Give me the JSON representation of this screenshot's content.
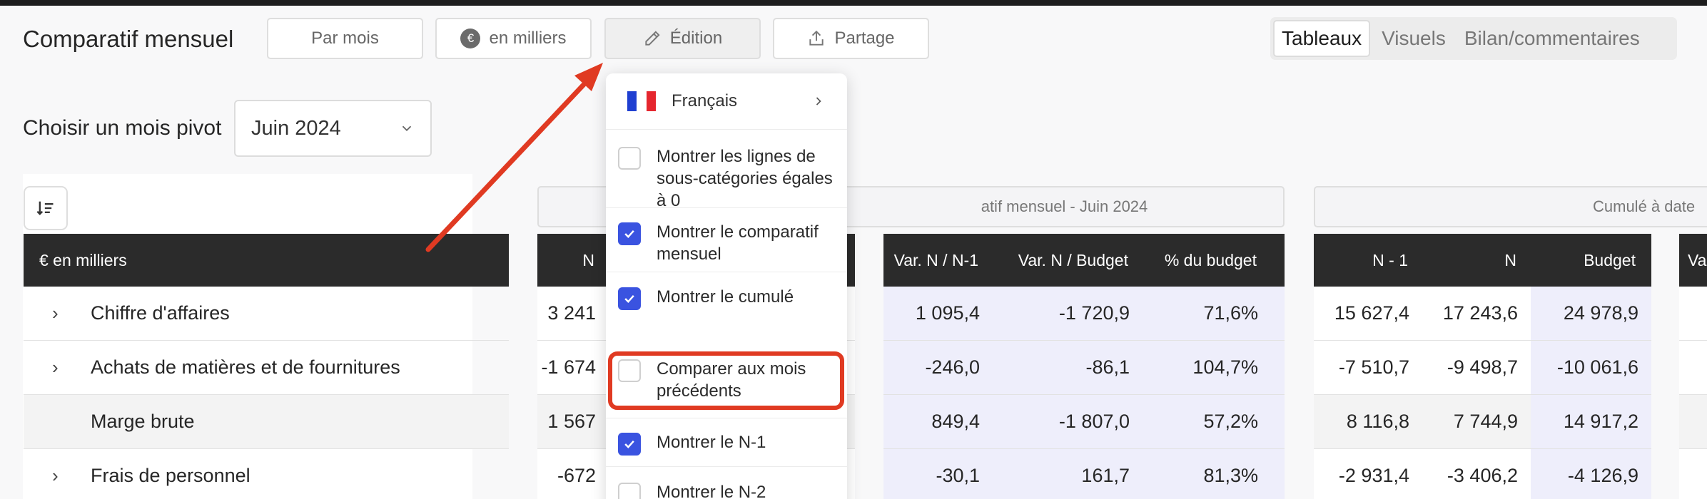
{
  "header": {
    "title": "Comparatif mensuel",
    "buttons": {
      "par_mois": "Par mois",
      "currency_badge": "€",
      "en_milliers": "en milliers",
      "edition": "Édition",
      "partage": "Partage"
    },
    "view_tabs": [
      "Tableaux",
      "Visuels",
      "Bilan/commentaires"
    ],
    "active_tab": "Tableaux"
  },
  "pivot": {
    "label": "Choisir un mois pivot",
    "value": "Juin 2024"
  },
  "tables": {
    "group_monthly": "Comparatif mensuel - Juin 2024",
    "group_monthly_visible": "atif mensuel - Juin 2024",
    "group_cumulative": "Cumulé à date",
    "label_header": "€ en milliers",
    "monthly_first_col_header": "N",
    "monthly_var_headers": [
      "Var. N / N-1",
      "Var. N / Budget",
      "% du budget"
    ],
    "cumulative_headers": [
      "N - 1",
      "N",
      "Budget",
      "Va"
    ],
    "rows": [
      {
        "label": "Chiffre d'affaires",
        "expandable": true,
        "n_partial": "3 241",
        "var": [
          "1 095,4",
          "-1 720,9",
          "71,6%"
        ],
        "cum": [
          "15 627,4",
          "17 243,6",
          "24 978,9"
        ]
      },
      {
        "label": "Achats de matières et de fournitures",
        "expandable": true,
        "n_partial": "-1 674",
        "var": [
          "-246,0",
          "-86,1",
          "104,7%"
        ],
        "cum": [
          "-7 510,7",
          "-9 498,7",
          "-10 061,6"
        ]
      },
      {
        "label": "Marge brute",
        "expandable": false,
        "n_partial": "1 567",
        "var": [
          "849,4",
          "-1 807,0",
          "57,2%"
        ],
        "cum": [
          "8 116,8",
          "7 744,9",
          "14 917,2"
        ]
      },
      {
        "label": "Frais de personnel",
        "expandable": true,
        "n_partial": "-672",
        "var": [
          "-30,1",
          "161,7",
          "81,3%"
        ],
        "cum": [
          "-2 931,4",
          "-3 406,2",
          "-4 126,9"
        ]
      }
    ]
  },
  "menu": {
    "language": "Français",
    "items": [
      {
        "label": "Montrer les lignes de sous-catégories égales à 0",
        "checked": false
      },
      {
        "label": "Montrer le comparatif mensuel",
        "checked": true
      },
      {
        "label": "Montrer le cumulé",
        "checked": true
      },
      {
        "label": "Comparer aux mois précédents",
        "checked": false
      },
      {
        "label": "Montrer le N-1",
        "checked": true
      },
      {
        "label": "Montrer le N-2",
        "checked": false
      }
    ]
  },
  "colors": {
    "accent_checkbox": "#3a53e0",
    "annotation_red": "#e03a22",
    "table_header": "#2b2b2b",
    "tint": "#eeeefb"
  },
  "icons": [
    "pencil-icon",
    "upload-icon",
    "chevron-down-icon",
    "chevron-right-icon",
    "sort-icon",
    "check-icon",
    "flag-fr-icon",
    "arrow-annotation-icon"
  ]
}
